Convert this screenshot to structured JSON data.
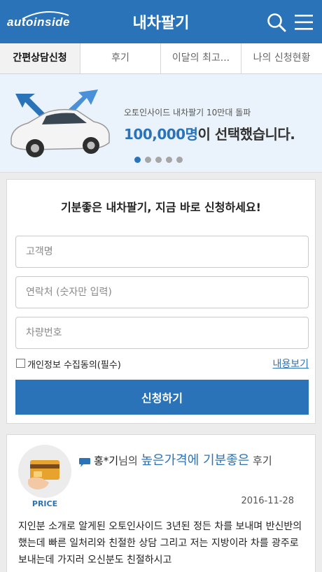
{
  "header": {
    "logo_text": "autoinside",
    "title": "내차팔기",
    "search_icon": "search-icon",
    "menu_icon": "hamburger-menu-icon",
    "brand_color": "#2b73b9"
  },
  "tabs": [
    {
      "label": "간편상담신청",
      "active": true
    },
    {
      "label": "후기",
      "active": false
    },
    {
      "label": "이달의 최고...",
      "active": false
    },
    {
      "label": "나의 신청현황",
      "active": false
    }
  ],
  "banner": {
    "subtitle": "오토인사이드 내차팔기 10만대 돌파",
    "count": "100,000명",
    "headline_rest": "이 선택했습니다.",
    "slide_count": 5,
    "active_slide": 1
  },
  "form": {
    "title": "기분좋은 내차팔기, 지금 바로 신청하세요!",
    "name_placeholder": "고객명",
    "phone_placeholder": "연락처 (숫자만 입력)",
    "car_placeholder": "차량번호",
    "name_value": "",
    "phone_value": "",
    "car_value": "",
    "agree_label": "개인정보 수집동의(필수)",
    "agree_checked": false,
    "terms_link": "내용보기",
    "submit_label": "신청하기"
  },
  "review": {
    "avatar_label": "PRICE",
    "avatar_icon": "credit-card-icon",
    "user": "홍*기",
    "suffix": "님의",
    "title": "높은가격에 기분좋은",
    "tail": "후기",
    "date": "2016-11-28",
    "body": "지인분 소개로 알게된 오토인사이드 3년된 정든 차를 보내며 반신반의했는데 빠른 일처리와 친절한 상담 그리고 저는 지방이라 차를 광주로 보내는데 가지러 오신분도 친절하시고"
  }
}
